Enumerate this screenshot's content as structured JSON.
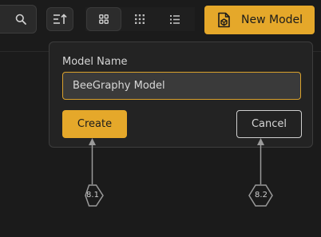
{
  "toolbar": {
    "icons": [
      "search-icon",
      "sort-icon",
      "grid-large-icon",
      "grid-small-icon",
      "list-icon",
      "model-file-icon"
    ],
    "new_model_label": "New Model"
  },
  "dialog": {
    "field_label": "Model Name",
    "input_value": "BeeGraphy Model",
    "create_label": "Create",
    "cancel_label": "Cancel"
  },
  "annotations": [
    {
      "label": "8.1",
      "target": "create-button"
    },
    {
      "label": "8.2",
      "target": "cancel-button"
    }
  ],
  "colors": {
    "background": "#1b1b1b",
    "accent": "#e5a82a",
    "panel": "#232323",
    "input_bg": "#3a3a3a",
    "annotation": "#9a9a9a"
  }
}
